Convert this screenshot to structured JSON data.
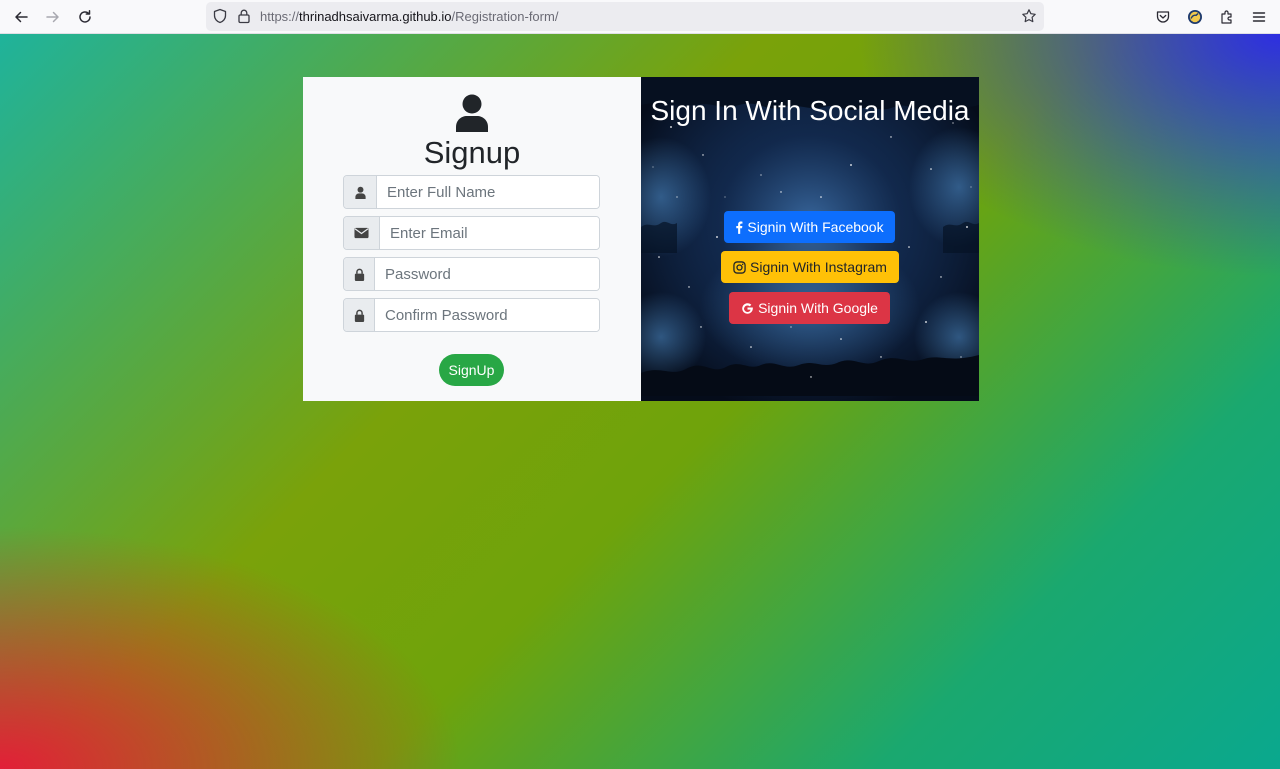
{
  "browser": {
    "url_prefix": "https://",
    "url_host": "thrinadhsaivarma.github.io",
    "url_path": "/Registration-form/"
  },
  "form": {
    "title": "Signup",
    "fields": {
      "full_name_placeholder": "Enter Full Name",
      "email_placeholder": "Enter Email",
      "password_placeholder": "Password",
      "confirm_password_placeholder": "Confirm Password"
    },
    "submit_label": "SignUp"
  },
  "social": {
    "title": "Sign In With Social Media",
    "facebook_label": "Signin With Facebook",
    "instagram_label": "Signin With Instagram",
    "google_label": "Signin With Google"
  },
  "colors": {
    "facebook": "#0d6efd",
    "instagram": "#ffc107",
    "google": "#dc3545",
    "signup": "#28a745"
  }
}
